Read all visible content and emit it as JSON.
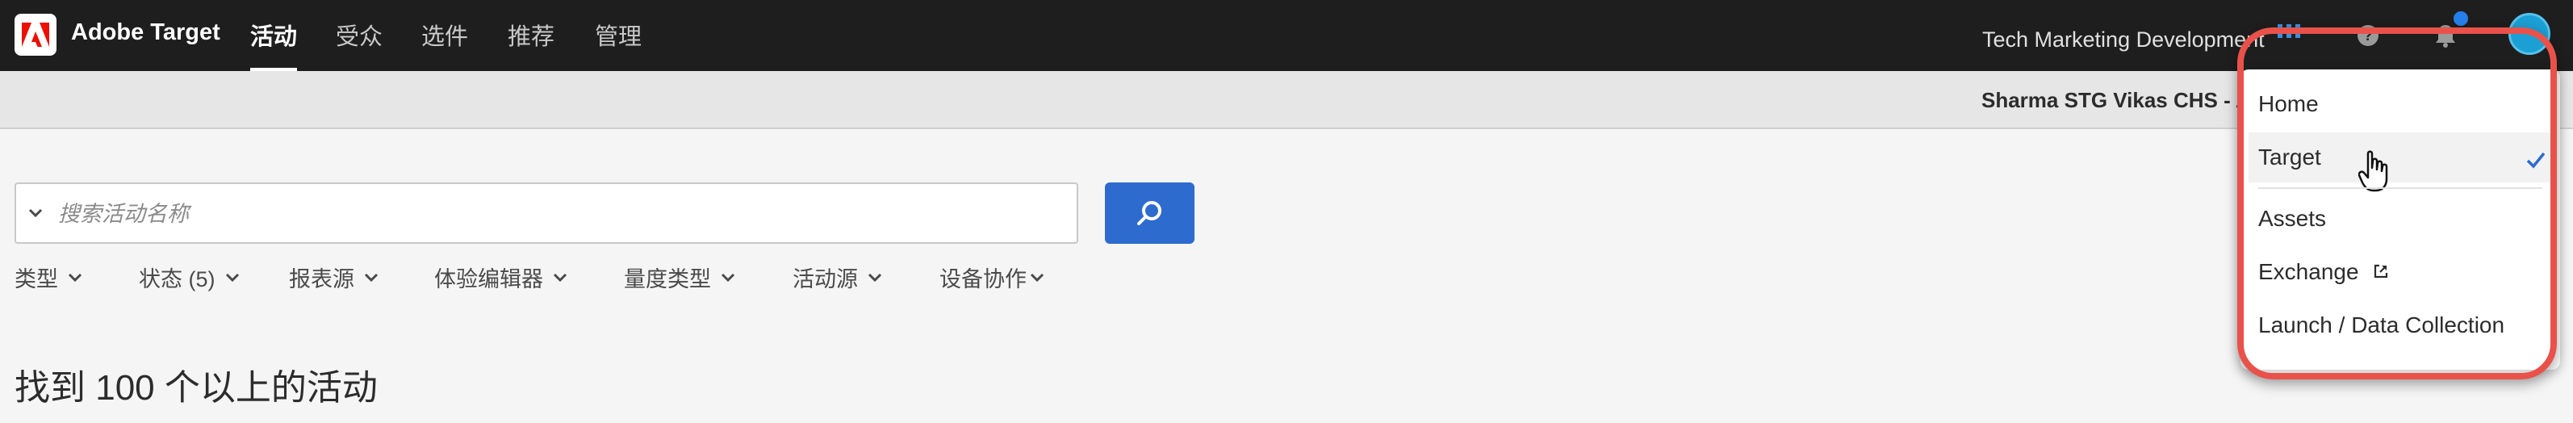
{
  "header": {
    "brand": "Adobe Target",
    "tabs": [
      {
        "label": "活动",
        "active": true
      },
      {
        "label": "受众",
        "active": false
      },
      {
        "label": "选件",
        "active": false
      },
      {
        "label": "推荐",
        "active": false
      },
      {
        "label": "管理",
        "active": false
      }
    ],
    "org_name": "Tech Marketing Development",
    "icons": [
      "apps-grid-icon",
      "help-icon",
      "bell-icon",
      "avatar"
    ],
    "accent_color": "#2d6bcf"
  },
  "subbar": {
    "workspace": "Sharma STG Vikas CHS - APP"
  },
  "search": {
    "placeholder": "搜索活动名称",
    "value": ""
  },
  "filters": [
    {
      "label": "类型"
    },
    {
      "label": "状态 (5)"
    },
    {
      "label": "报表源"
    },
    {
      "label": "体验编辑器"
    },
    {
      "label": "量度类型"
    },
    {
      "label": "活动源"
    },
    {
      "label": "设备协作"
    }
  ],
  "results": {
    "heading": "找到 100 个以上的活动"
  },
  "app_switcher": {
    "items": [
      {
        "label": "Home",
        "selected": false
      },
      {
        "label": "Target",
        "selected": true
      },
      {
        "label": "Assets",
        "selected": false
      },
      {
        "label": "Exchange",
        "selected": false,
        "external": true
      },
      {
        "label": "Launch / Data Collection",
        "selected": false
      }
    ],
    "highlight_color": "#e8524a"
  }
}
